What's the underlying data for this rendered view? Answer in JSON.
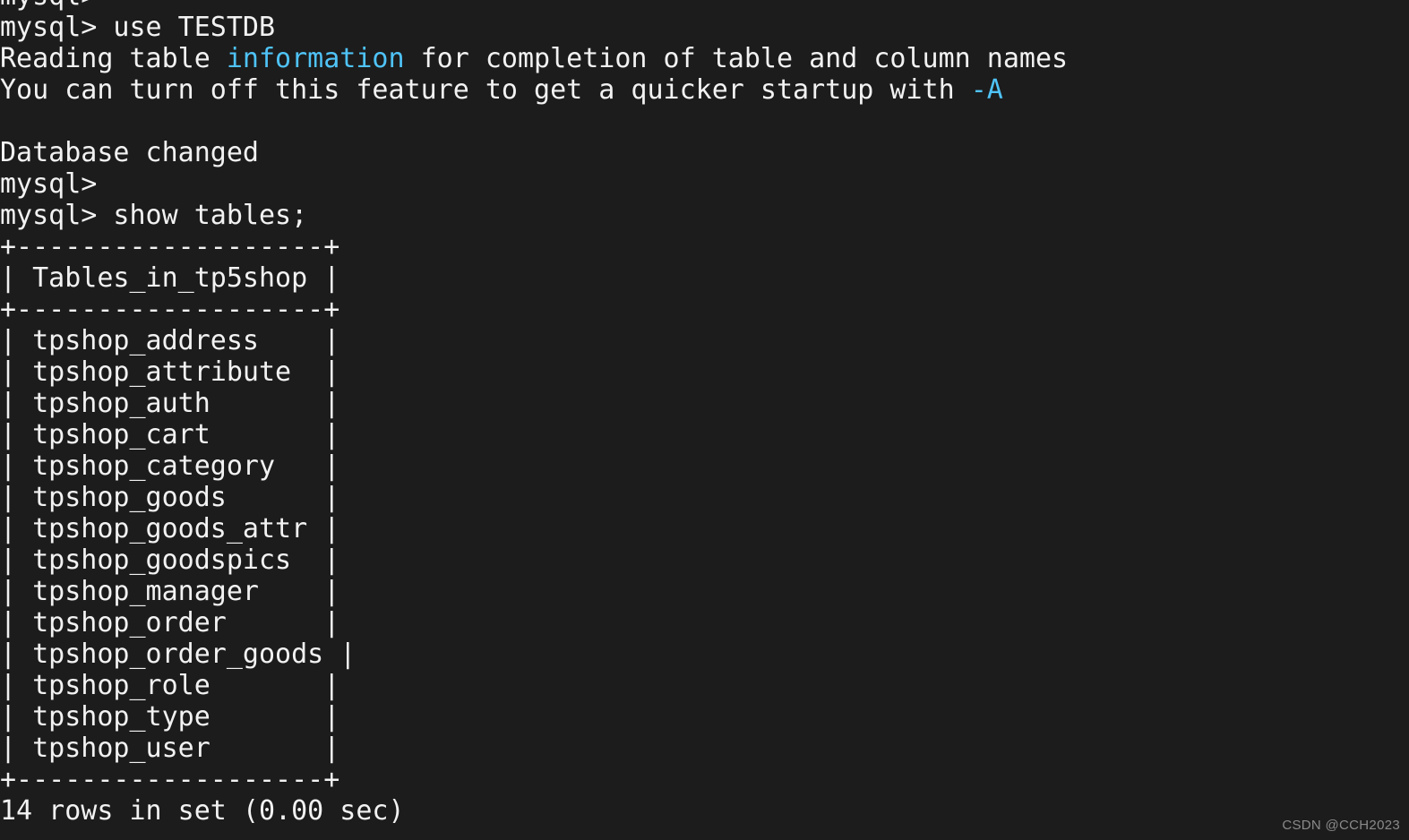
{
  "terminal": {
    "background_color": "#1c1c1c",
    "foreground_color": "#f2f2f2",
    "accent_color": "#4fc3f7",
    "prompt": "mysql>",
    "lines": [
      {
        "id": "line-0-partial-prompt",
        "segments": [
          {
            "text": "mysql>",
            "color": "default"
          }
        ]
      },
      {
        "id": "line-1-use-testdb",
        "segments": [
          {
            "text": "mysql> use TESTDB",
            "color": "default"
          }
        ]
      },
      {
        "id": "line-2-reading-table",
        "segments": [
          {
            "text": "Reading table ",
            "color": "default"
          },
          {
            "text": "information",
            "color": "accent"
          },
          {
            "text": " for completion of table and column names",
            "color": "default"
          }
        ]
      },
      {
        "id": "line-3-turn-off",
        "segments": [
          {
            "text": "You can turn off this feature to get a quicker startup with ",
            "color": "default"
          },
          {
            "text": "-A",
            "color": "accent"
          }
        ]
      },
      {
        "id": "line-4-blank",
        "segments": [
          {
            "text": "",
            "color": "default"
          }
        ]
      },
      {
        "id": "line-5-database-changed",
        "segments": [
          {
            "text": "Database changed",
            "color": "default"
          }
        ]
      },
      {
        "id": "line-6-empty-prompt",
        "segments": [
          {
            "text": "mysql>",
            "color": "default"
          }
        ]
      },
      {
        "id": "line-7-show-tables",
        "segments": [
          {
            "text": "mysql> show tables;",
            "color": "default"
          }
        ]
      },
      {
        "id": "line-8-rule-top",
        "segments": [
          {
            "text": "+-------------------+",
            "color": "default"
          }
        ]
      },
      {
        "id": "line-9-header",
        "segments": [
          {
            "text": "| Tables_in_tp5shop |",
            "color": "default"
          }
        ]
      },
      {
        "id": "line-10-rule-mid",
        "segments": [
          {
            "text": "+-------------------+",
            "color": "default"
          }
        ]
      },
      {
        "id": "line-11-row-address",
        "segments": [
          {
            "text": "| tpshop_address    |",
            "color": "default"
          }
        ]
      },
      {
        "id": "line-12-row-attribute",
        "segments": [
          {
            "text": "| tpshop_attribute  |",
            "color": "default"
          }
        ]
      },
      {
        "id": "line-13-row-auth",
        "segments": [
          {
            "text": "| tpshop_auth       |",
            "color": "default"
          }
        ]
      },
      {
        "id": "line-14-row-cart",
        "segments": [
          {
            "text": "| tpshop_cart       |",
            "color": "default"
          }
        ]
      },
      {
        "id": "line-15-row-category",
        "segments": [
          {
            "text": "| tpshop_category   |",
            "color": "default"
          }
        ]
      },
      {
        "id": "line-16-row-goods",
        "segments": [
          {
            "text": "| tpshop_goods      |",
            "color": "default"
          }
        ]
      },
      {
        "id": "line-17-row-goods-attr",
        "segments": [
          {
            "text": "| tpshop_goods_attr |",
            "color": "default"
          }
        ]
      },
      {
        "id": "line-18-row-goodspics",
        "segments": [
          {
            "text": "| tpshop_goodspics  |",
            "color": "default"
          }
        ]
      },
      {
        "id": "line-19-row-manager",
        "segments": [
          {
            "text": "| tpshop_manager    |",
            "color": "default"
          }
        ]
      },
      {
        "id": "line-20-row-order",
        "segments": [
          {
            "text": "| tpshop_order      |",
            "color": "default"
          }
        ]
      },
      {
        "id": "line-21-row-order-goods",
        "segments": [
          {
            "text": "| tpshop_order_goods |",
            "color": "default"
          }
        ]
      },
      {
        "id": "line-22-row-role",
        "segments": [
          {
            "text": "| tpshop_role       |",
            "color": "default"
          }
        ]
      },
      {
        "id": "line-23-row-type",
        "segments": [
          {
            "text": "| tpshop_type       |",
            "color": "default"
          }
        ]
      },
      {
        "id": "line-24-row-user",
        "segments": [
          {
            "text": "| tpshop_user       |",
            "color": "default"
          }
        ]
      },
      {
        "id": "line-25-rule-bottom",
        "segments": [
          {
            "text": "+-------------------+",
            "color": "default"
          }
        ]
      },
      {
        "id": "line-26-row-count",
        "segments": [
          {
            "text": "14 rows in set (0.00 sec)",
            "color": "default"
          }
        ]
      }
    ]
  },
  "query_result": {
    "statement": "show tables;",
    "database": "TESTDB",
    "column_header": "Tables_in_tp5shop",
    "rows": [
      "tpshop_address",
      "tpshop_attribute",
      "tpshop_auth",
      "tpshop_cart",
      "tpshop_category",
      "tpshop_goods",
      "tpshop_goods_attr",
      "tpshop_goodspics",
      "tpshop_manager",
      "tpshop_order",
      "tpshop_order_goods",
      "tpshop_role",
      "tpshop_type",
      "tpshop_user"
    ],
    "row_count_text": "14 rows in set (0.00 sec)",
    "row_count": 14,
    "elapsed": "0.00 sec"
  },
  "watermark": {
    "text": "CSDN @CCH2023"
  }
}
